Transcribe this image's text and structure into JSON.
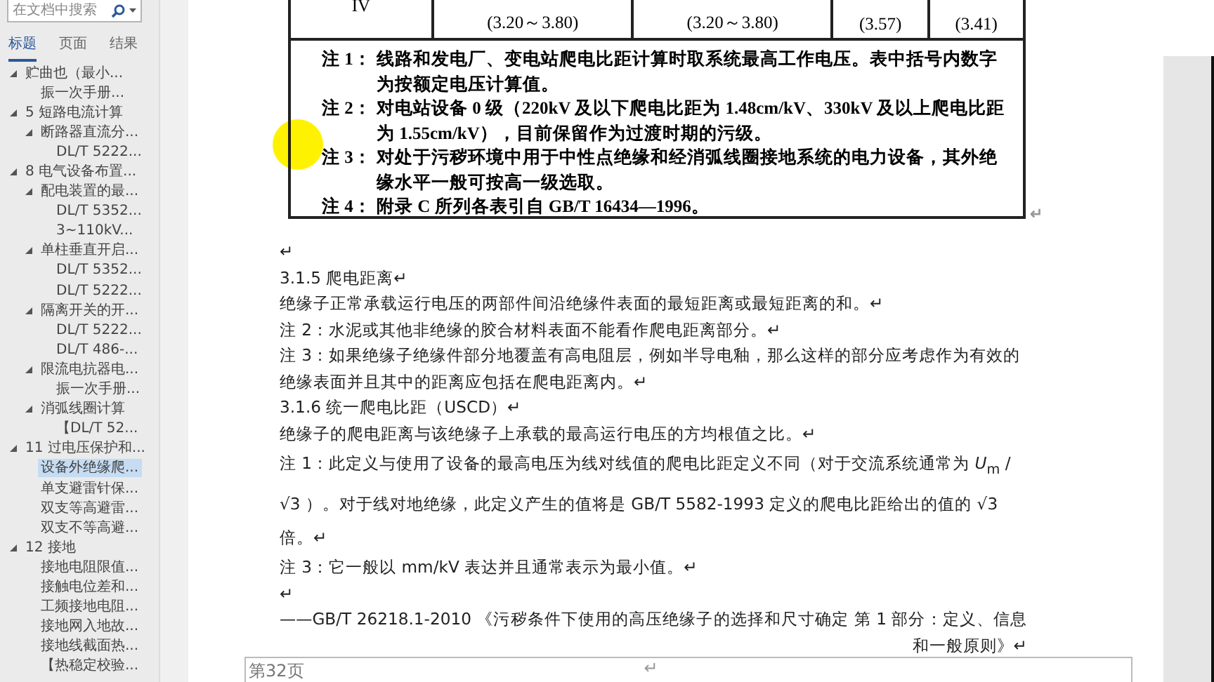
{
  "nav": {
    "search": {
      "placeholder": "在文档中搜索"
    },
    "tabs": [
      {
        "label": "标题",
        "selected": true
      },
      {
        "label": "页面",
        "selected": false
      },
      {
        "label": "结果",
        "selected": false
      }
    ],
    "tree": [
      {
        "children": [
          {
            "label": "贮曲也（最小...",
            "expanded": true,
            "selected": false,
            "children": [
              {
                "label": "振一次手册...",
                "selected": false
              }
            ]
          }
        ]
      },
      {
        "label": "5  短路电流计算",
        "expanded": true,
        "selected": false,
        "children": [
          {
            "label": "断路器直流分...",
            "expanded": true,
            "selected": false,
            "children": [
              {
                "label": "DL/T  5222...",
                "selected": false
              }
            ]
          }
        ]
      },
      {
        "label": "8  电气设备布置...",
        "expanded": true,
        "selected": false,
        "children": [
          {
            "label": "配电装置的最...",
            "expanded": true,
            "selected": false,
            "children": [
              {
                "label": "DL/T 5352...",
                "selected": false
              },
              {
                "label": "3~110kV...",
                "selected": false
              }
            ]
          },
          {
            "label": "单柱垂直开启...",
            "expanded": true,
            "selected": false,
            "children": [
              {
                "label": "DL/T 5352...",
                "selected": false
              },
              {
                "label": "DL/T 5222...",
                "selected": false
              }
            ]
          },
          {
            "label": "隔离开关的开...",
            "expanded": true,
            "selected": false,
            "children": [
              {
                "label": "DL/T 5222...",
                "selected": false
              },
              {
                "label": "DL/T 486-...",
                "selected": false
              }
            ]
          },
          {
            "label": "限流电抗器电...",
            "expanded": true,
            "selected": false,
            "children": [
              {
                "label": "振一次手册...",
                "selected": false
              }
            ]
          },
          {
            "label": "消弧线圈计算",
            "expanded": true,
            "selected": false,
            "children": [
              {
                "label": "【DL/T 52...",
                "selected": false
              }
            ]
          }
        ]
      },
      {
        "label": "11  过电压保护和...",
        "expanded": true,
        "selected": false,
        "children": [
          {
            "label": "设备外绝缘爬...",
            "selected": true
          },
          {
            "label": "单支避雷针保...",
            "selected": false
          },
          {
            "label": "双支等高避雷...",
            "selected": false
          },
          {
            "label": "双支不等高避...",
            "selected": false
          }
        ]
      },
      {
        "label": "12  接地",
        "expanded": true,
        "selected": false,
        "children": [
          {
            "label": "接地电阻限值...",
            "selected": false
          },
          {
            "label": "接触电位差和...",
            "selected": false
          },
          {
            "label": "工频接地电阻...",
            "selected": false
          },
          {
            "label": "接地网入地故...",
            "selected": false
          },
          {
            "label": "接地线截面热...",
            "selected": false
          },
          {
            "label": "【热稳定校验...",
            "selected": false
          }
        ]
      }
    ]
  },
  "document": {
    "table": {
      "row_label": "IV",
      "values": [
        "(3.20～3.80)",
        "(3.20～3.80)",
        "(3.57)",
        "(3.41)"
      ],
      "notes": [
        {
          "label": "注 1：",
          "text": "线路和发电厂、变电站爬电比距计算时取系统最高工作电压。表中括号内数字为按额定电压计算值。"
        },
        {
          "label": "注 2：",
          "text": "对电站设备 0 级（220kV 及以下爬电比距为 1.48cm/kV、330kV 及以上爬电比距为 1.55cm/kV），目前保留作为过渡时期的污级。"
        },
        {
          "label": "注 3：",
          "text": "对处于污秽环境中用于中性点绝缘和经消弧线圈接地系统的电力设备，其外绝缘水平一般可按高一级选取。"
        },
        {
          "label": "注 4：",
          "text": "附录 C 所列各表引自 GB/T 16434—1996。"
        }
      ],
      "end_mark": "↵"
    },
    "paragraphs": [
      {
        "kind": "text",
        "text": "↵"
      },
      {
        "kind": "heading",
        "text": "3.1.5  爬电距离↵"
      },
      {
        "kind": "text",
        "text": "绝缘子正常承载运行电压的两部件间沿绝缘件表面的最短距离或最短距离的和。↵"
      },
      {
        "kind": "text",
        "text": "注 2：水泥或其他非绝缘的胶合材料表面不能看作爬电距离部分。↵"
      },
      {
        "kind": "text",
        "text": "注 3：如果绝缘子绝缘件部分地覆盖有高电阻层，例如半导电釉，那么这样的部分应考虑作为有效的绝缘表面并且其中的距离应包括在爬电距离内。↵"
      },
      {
        "kind": "heading",
        "text": "3.1.6  统一爬电比距（USCD）↵"
      },
      {
        "kind": "text",
        "text": "绝缘子的爬电距离与该绝缘子上承载的最高运行电压的方均根值之比。↵"
      },
      {
        "kind": "formula",
        "text": "注  1：此定义与使用了设备的最高电压为线对线值的爬电比距定义不同（对于交流系统通常为 *U*$_{m}$ / √3 ）。对于线对地绝缘，此定义产生的值将是 GB/T 5582-1993 定义的爬电比距给出的值的 √3 倍。↵"
      },
      {
        "kind": "text",
        "text": "注 3：它一般以 mm/kV 表达并且通常表示为最小值。↵"
      },
      {
        "kind": "text",
        "text": "↵"
      },
      {
        "kind": "citation",
        "text": "——GB/T 26218.1-2010 《污秽条件下使用的高压绝缘子的选择和尺寸确定  第 1 部分：定义、信息和一般原则》↵"
      }
    ],
    "footer": {
      "page": "第32页",
      "mark": "↵"
    }
  }
}
